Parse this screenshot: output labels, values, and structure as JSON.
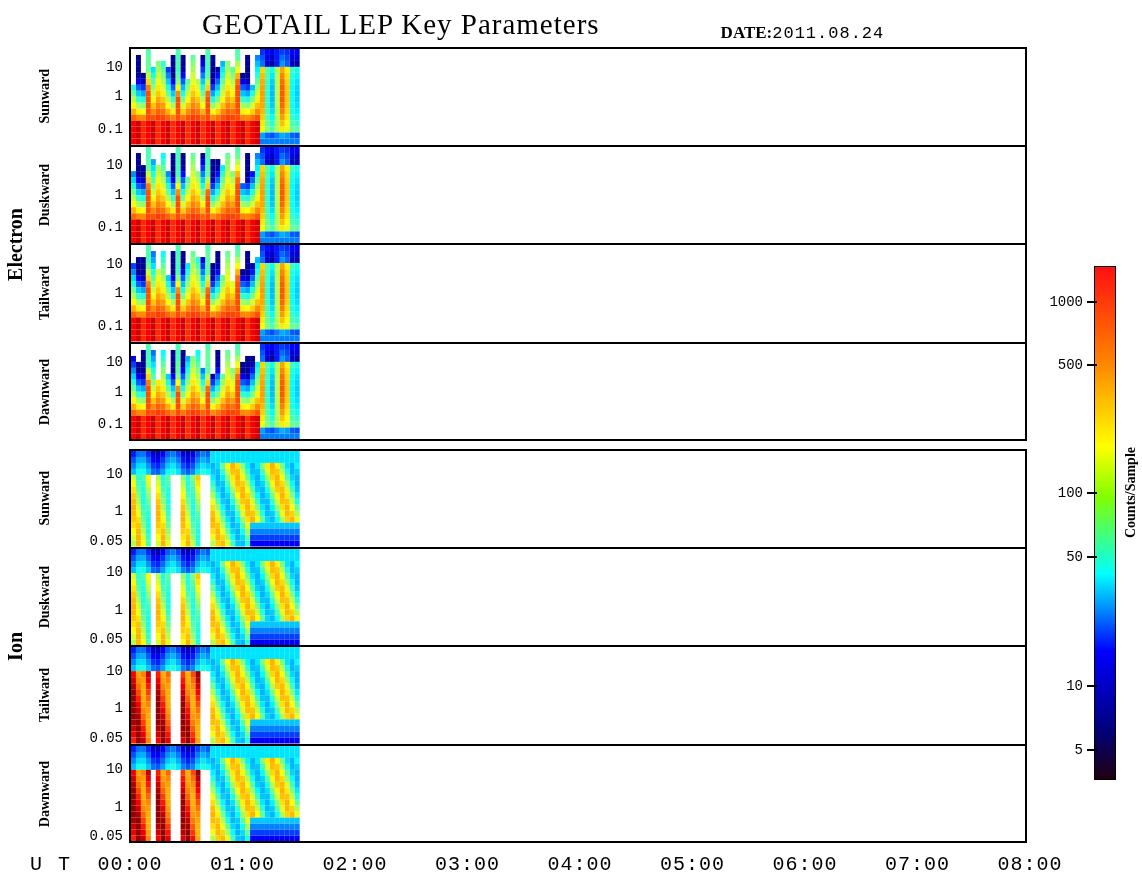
{
  "title": "GEOTAIL LEP Key Parameters",
  "date": {
    "label": "DATE:",
    "value": "2011.08.24"
  },
  "groups": [
    {
      "name": "Electron",
      "kind": "electron",
      "panels": [
        {
          "label": "Sunward",
          "ticks": [
            "10",
            "1",
            "0.1"
          ]
        },
        {
          "label": "Duskward",
          "ticks": [
            "10",
            "1",
            "0.1"
          ]
        },
        {
          "label": "Tailward",
          "ticks": [
            "10",
            "1",
            "0.1"
          ]
        },
        {
          "label": "Dawnward",
          "ticks": [
            "10",
            "1",
            "0.1"
          ]
        }
      ]
    },
    {
      "name": "Ion",
      "kind": "ion",
      "panels": [
        {
          "label": "Sunward",
          "ticks": [
            "10",
            "1",
            "0.05"
          ]
        },
        {
          "label": "Duskward",
          "ticks": [
            "10",
            "1",
            "0.05"
          ]
        },
        {
          "label": "Tailward",
          "ticks": [
            "10",
            "1",
            "0.05"
          ]
        },
        {
          "label": "Dawnward",
          "ticks": [
            "10",
            "1",
            "0.05"
          ]
        }
      ]
    }
  ],
  "time_axis": {
    "label": "U T",
    "ticks": [
      "00:00",
      "01:00",
      "02:00",
      "03:00",
      "04:00",
      "05:00",
      "06:00",
      "07:00",
      "08:00"
    ]
  },
  "colorbar": {
    "label": "Counts/Sample",
    "ticks": [
      "1000",
      "500",
      "100",
      "50",
      "10",
      "5"
    ]
  }
}
